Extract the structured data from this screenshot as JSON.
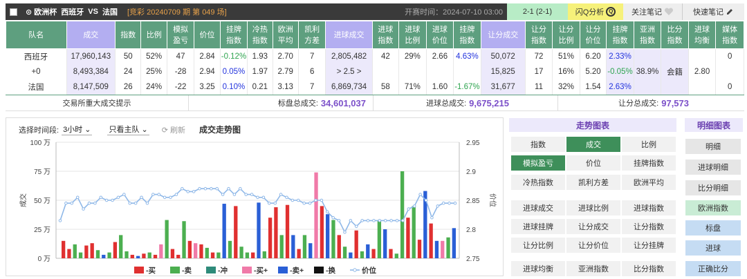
{
  "topbar": {
    "league": "⊙ 欧洲杯",
    "home": "西班牙",
    "vs": "VS",
    "away": "法国",
    "issue": "[竞彩 20240709 期 第 049 场]",
    "start_time": "开赛时间：2024-07-10 03:00",
    "score": "2-1 (2-1)",
    "flash": "闪Q分析",
    "follow": "关注笔记",
    "quick": "快速笔记"
  },
  "table": {
    "headers": [
      "队名",
      "成交",
      "指数",
      "比例",
      "模拟\n盈亏",
      "价位",
      "挂牌\n指数",
      "冷热\n指数",
      "欧洲\n平均",
      "凯利\n方差",
      "进球成交",
      "进球\n指数",
      "进球\n比例",
      "进球\n价位",
      "挂牌\n指数",
      "让分成交",
      "让分\n指数",
      "让分\n比例",
      "让分\n价位",
      "挂牌\n指数",
      "亚洲\n指数",
      "比分\n指数",
      "进球\n均衡",
      "媒体\n指数"
    ],
    "rows": [
      [
        "西班牙",
        "17,960,143",
        "50",
        "52%",
        "47",
        "2.84",
        "-0.12%",
        "1.93",
        "2.70",
        "7",
        "2,805,482",
        "42",
        "29%",
        "2.66",
        "4.63%",
        "50,072",
        "72",
        "51%",
        "6.20",
        "2.33%",
        "",
        "",
        "",
        "0"
      ],
      [
        "+0",
        "8,493,384",
        "24",
        "25%",
        "-28",
        "2.94",
        "0.05%",
        "1.97",
        "2.79",
        "6",
        "> 2.5 >",
        "",
        "",
        "",
        "",
        "15,825",
        "17",
        "16%",
        "5.20",
        "-0.05%",
        "38.9%",
        "会籍",
        "2.80",
        ""
      ],
      [
        "法国",
        "8,147,509",
        "26",
        "24%",
        "-22",
        "3.25",
        "0.10%",
        "0.21",
        "3.13",
        "7",
        "6,869,734",
        "58",
        "71%",
        "1.60",
        "-1.67%",
        "31,677",
        "11",
        "32%",
        "1.54",
        "2.63%",
        "",
        "",
        "",
        "0"
      ]
    ]
  },
  "summary": {
    "hint": "交易所重大成交提示",
    "total_label": "标盘总成交:",
    "total": "34,601,037",
    "goal_label": "进球总成交:",
    "goal": "9,675,215",
    "hcp_label": "让分总成交:",
    "hcp": "97,573"
  },
  "chart_controls": {
    "period_label": "选择时间段:",
    "period": "3小时 ⌄",
    "filter": "只看主队 ⌄",
    "refresh": "⟳ 刷新",
    "title": "成交走势图"
  },
  "chart_data": {
    "type": "bar",
    "ylabel": "成交",
    "y2label": "价位",
    "ylim": [
      0,
      100
    ],
    "yticks": [
      "0 万",
      "25 万",
      "50 万",
      "75 万",
      "100 万"
    ],
    "y2lim": [
      2.75,
      2.95
    ],
    "y2ticks": [
      "2.75",
      "2.8",
      "2.85",
      "2.9",
      "2.95"
    ],
    "legend": [
      "-买",
      "-卖",
      "-冲",
      "-买+",
      "-卖+",
      "-换",
      "价位"
    ],
    "colors": [
      "#e03030",
      "#4caf50",
      "#2e8b7a",
      "#f07aa8",
      "#2a5fd6",
      "#111111",
      "#8fb8e8"
    ],
    "bars": [
      [
        0,
        15
      ],
      [
        0,
        8
      ],
      [
        1,
        12
      ],
      [
        1,
        5
      ],
      [
        0,
        11
      ],
      [
        0,
        13
      ],
      [
        1,
        7
      ],
      [
        4,
        3
      ],
      [
        1,
        5
      ],
      [
        0,
        14
      ],
      [
        1,
        20
      ],
      [
        1,
        6
      ],
      [
        0,
        3
      ],
      [
        4,
        2
      ],
      [
        0,
        4
      ],
      [
        1,
        5
      ],
      [
        0,
        3
      ],
      [
        3,
        12
      ],
      [
        1,
        33
      ],
      [
        0,
        8
      ],
      [
        0,
        3
      ],
      [
        1,
        32
      ],
      [
        0,
        15
      ],
      [
        3,
        13
      ],
      [
        0,
        12
      ],
      [
        1,
        9
      ],
      [
        0,
        5
      ],
      [
        1,
        5
      ],
      [
        4,
        47
      ],
      [
        1,
        15
      ],
      [
        0,
        45
      ],
      [
        1,
        10
      ],
      [
        1,
        5
      ],
      [
        0,
        5
      ],
      [
        4,
        48
      ],
      [
        1,
        6
      ],
      [
        0,
        35
      ],
      [
        0,
        44
      ],
      [
        1,
        20
      ],
      [
        0,
        46
      ],
      [
        4,
        20
      ],
      [
        0,
        8
      ],
      [
        1,
        20
      ],
      [
        4,
        13
      ],
      [
        3,
        74
      ],
      [
        0,
        45
      ],
      [
        4,
        38
      ],
      [
        1,
        33
      ],
      [
        0,
        20
      ],
      [
        1,
        10
      ],
      [
        4,
        5
      ],
      [
        0,
        24
      ],
      [
        1,
        6
      ],
      [
        4,
        12
      ],
      [
        0,
        8
      ],
      [
        1,
        33
      ],
      [
        4,
        25
      ],
      [
        0,
        8
      ],
      [
        1,
        4
      ],
      [
        1,
        75
      ],
      [
        0,
        35
      ],
      [
        1,
        45
      ],
      [
        0,
        16
      ],
      [
        4,
        58
      ],
      [
        0,
        30
      ],
      [
        4,
        15
      ],
      [
        3,
        15
      ],
      [
        1,
        18
      ],
      [
        4,
        26
      ]
    ],
    "price": [
      2.815,
      2.845,
      2.845,
      2.855,
      2.835,
      2.845,
      2.845,
      2.855,
      2.85,
      2.85,
      2.855,
      2.86,
      2.845,
      2.845,
      2.855,
      2.845,
      2.86,
      2.86,
      2.855,
      2.855,
      2.86,
      2.87,
      2.865,
      2.865,
      2.87,
      2.87,
      2.87,
      2.87,
      2.86,
      2.87,
      2.86,
      2.87,
      2.86,
      2.86,
      2.855,
      2.855,
      2.845,
      2.845,
      2.86,
      2.855,
      2.85,
      2.85,
      2.845,
      2.845,
      2.85,
      2.85,
      2.83,
      2.82,
      2.815,
      2.795,
      2.815,
      2.805,
      2.815,
      2.815,
      2.815,
      2.815,
      2.815,
      2.815,
      2.815,
      2.815,
      2.835,
      2.84,
      2.86,
      2.85,
      2.82,
      2.84,
      2.845,
      2.845,
      2.845
    ]
  },
  "trend_panel": {
    "title": "走势图表",
    "buttons": [
      "指数",
      "成交",
      "比例",
      "模拟盈亏",
      "价位",
      "挂牌指数",
      "冷热指数",
      "凯利方差",
      "欧洲平均",
      "进球成交",
      "进球比例",
      "进球指数",
      "进球挂牌",
      "让分成交",
      "让分指数",
      "让分比例",
      "让分价位",
      "让分挂牌",
      "进球均衡",
      "亚洲指数",
      "比分指数"
    ]
  },
  "detail_panel": {
    "title": "明细图表",
    "buttons": [
      "明细",
      "进球明细",
      "比分明细",
      "欧洲指数",
      "标盘",
      "进球",
      "正确比分"
    ]
  }
}
